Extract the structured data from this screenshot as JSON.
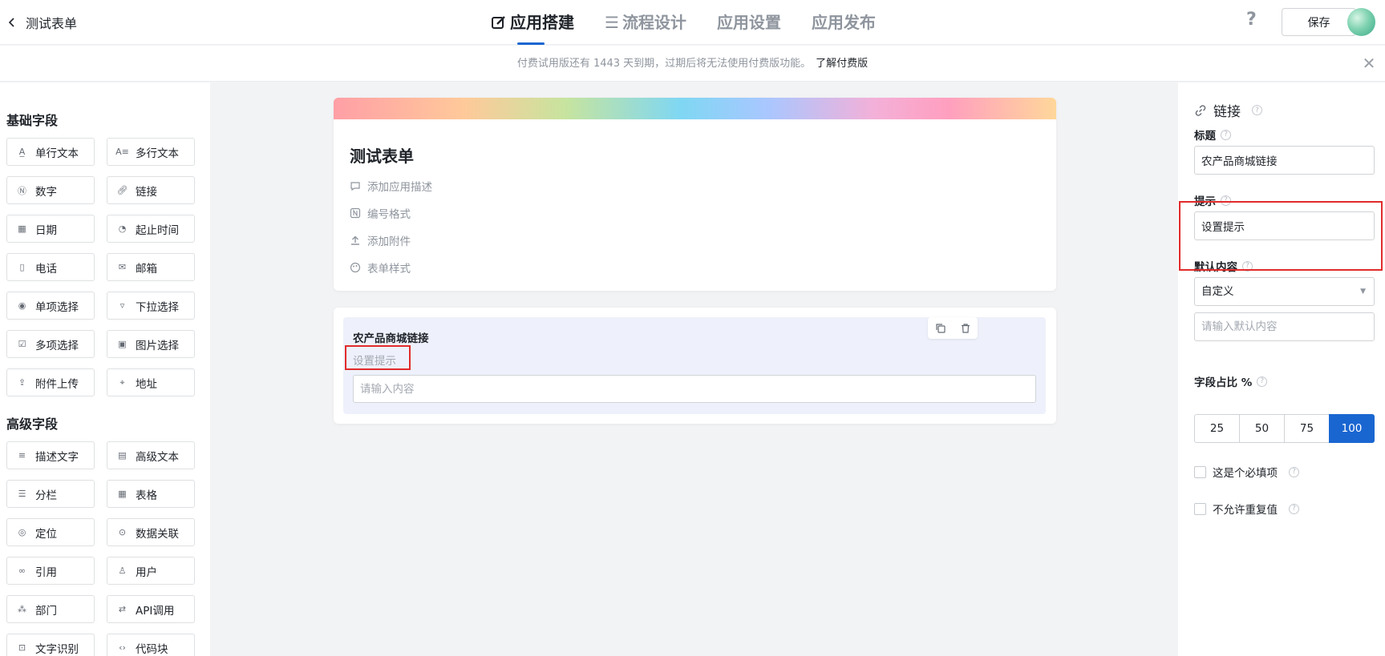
{
  "header": {
    "back_title": "测试表单",
    "tabs": [
      {
        "label": "应用搭建",
        "active": true
      },
      {
        "label": "流程设计",
        "active": false
      },
      {
        "label": "应用设置",
        "active": false
      },
      {
        "label": "应用发布",
        "active": false
      }
    ],
    "help": "?",
    "save_label": "保存"
  },
  "notice": {
    "text": "付费试用版还有 1443 天到期，过期后将无法使用付费版功能。",
    "link": "了解付费版",
    "close": "✕"
  },
  "left_panel": {
    "basic_title": "基础字段",
    "basic_fields": [
      {
        "label": "单行文本",
        "icon": "single-line-text-icon"
      },
      {
        "label": "多行文本",
        "icon": "multi-line-text-icon"
      },
      {
        "label": "数字",
        "icon": "number-icon"
      },
      {
        "label": "链接",
        "icon": "link-icon"
      },
      {
        "label": "日期",
        "icon": "date-icon"
      },
      {
        "label": "起止时间",
        "icon": "time-range-icon"
      },
      {
        "label": "电话",
        "icon": "phone-icon"
      },
      {
        "label": "邮箱",
        "icon": "email-icon"
      },
      {
        "label": "单项选择",
        "icon": "radio-icon"
      },
      {
        "label": "下拉选择",
        "icon": "dropdown-icon"
      },
      {
        "label": "多项选择",
        "icon": "checkbox-icon"
      },
      {
        "label": "图片选择",
        "icon": "image-icon"
      },
      {
        "label": "附件上传",
        "icon": "upload-icon"
      },
      {
        "label": "地址",
        "icon": "address-icon"
      }
    ],
    "advanced_title": "高级字段",
    "advanced_fields": [
      {
        "label": "描述文字",
        "icon": "description-icon"
      },
      {
        "label": "高级文本",
        "icon": "rich-text-icon"
      },
      {
        "label": "分栏",
        "icon": "columns-icon"
      },
      {
        "label": "表格",
        "icon": "table-icon"
      },
      {
        "label": "定位",
        "icon": "location-icon"
      },
      {
        "label": "数据关联",
        "icon": "data-link-icon"
      },
      {
        "label": "引用",
        "icon": "reference-icon"
      },
      {
        "label": "用户",
        "icon": "user-icon"
      },
      {
        "label": "部门",
        "icon": "department-icon"
      },
      {
        "label": "API调用",
        "icon": "api-icon"
      },
      {
        "label": "文字识别",
        "icon": "ocr-icon"
      },
      {
        "label": "代码块",
        "icon": "code-icon"
      }
    ]
  },
  "canvas": {
    "form_title": "测试表单",
    "meta": [
      {
        "label": "添加应用描述",
        "icon": "comment-icon"
      },
      {
        "label": "编号格式",
        "icon": "number-format-icon"
      },
      {
        "label": "添加附件",
        "icon": "upload-icon"
      },
      {
        "label": "表单样式",
        "icon": "palette-icon"
      }
    ],
    "field": {
      "label": "农产品商城链接",
      "hint": "设置提示",
      "placeholder": "请输入内容"
    }
  },
  "right_panel": {
    "title": "链接",
    "title_label": "标题",
    "title_value": "农产品商城链接",
    "hint_label": "提示",
    "hint_value": "设置提示",
    "default_label": "默认内容",
    "default_select": "自定义",
    "default_placeholder": "请输入默认内容",
    "ratio_label": "字段占比 %",
    "ratio_options": [
      "25",
      "50",
      "75",
      "100"
    ],
    "ratio_selected": "100",
    "required_label": "这是个必填项",
    "no_duplicate_label": "不允许重复值"
  },
  "colors": {
    "accent": "#1a66d1",
    "highlight_border": "#e12b2b"
  }
}
